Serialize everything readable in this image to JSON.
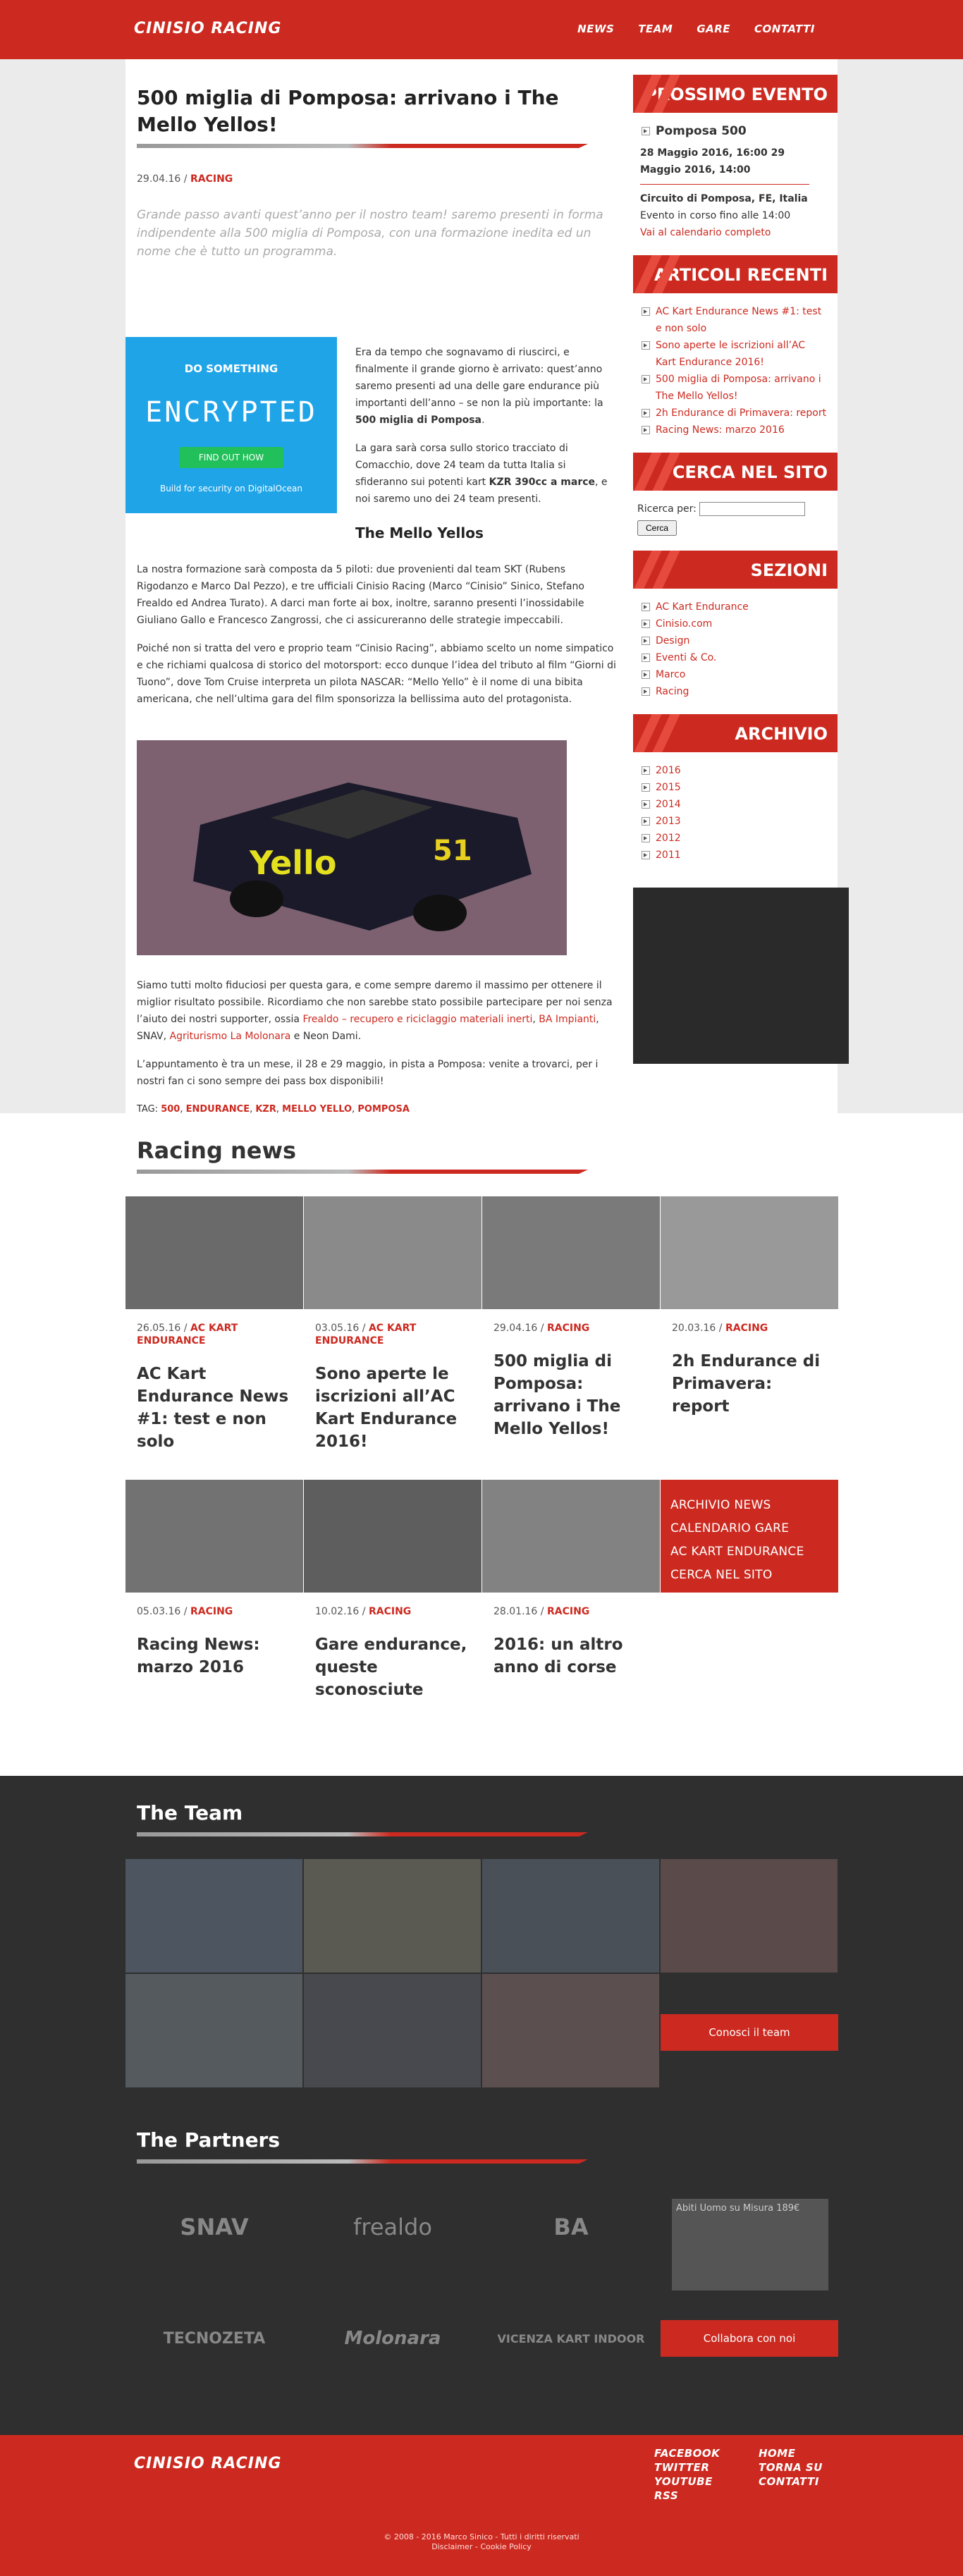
{
  "header": {
    "logo": "CINISIO RACING",
    "nav": [
      "NEWS",
      "TEAM",
      "GARE",
      "CONTATTI"
    ]
  },
  "post": {
    "title": "500 miglia di Pomposa: arrivano i The Mello Yellos!",
    "date": "29.04.16",
    "category": "RACING",
    "lead": "Grande passo avanti quest’anno per il nostro team! saremo presenti in forma indipendente alla 500 miglia di Pomposa, con una formazione inedita ed un nome che è tutto un programma.",
    "p1_a": "Era da tempo che sognavamo di riuscirci, e finalmente il grande giorno è arrivato: quest’anno saremo presenti ad una delle gare endurance più importanti dell’anno – se non la più importante: la ",
    "p1_b": "500 miglia di Pomposa",
    "p1_c": ".",
    "p2_a": "La gara sarà corsa sullo storico tracciato di Comacchio, dove 24 team da tutta Italia si sfideranno sui potenti kart ",
    "p2_b": "KZR 390cc a marce",
    "p2_c": ", e noi saremo uno dei 24 team presenti.",
    "subheading": "The Mello Yellos",
    "p3": "La nostra formazione sarà composta da 5 piloti: due provenienti dal team SKT (Rubens Rigodanzo e Marco Dal Pezzo), e tre ufficiali Cinisio Racing (Marco “Cinisio” Sinico, Stefano Frealdo ed Andrea Turato). A darci man forte ai box, inoltre, saranno presenti l’inossidabile Giuliano Gallo e Francesco Zangrossi, che ci assicureranno delle strategie impeccabili.",
    "p4": "Poiché non si tratta del vero e proprio team “Cinisio Racing”, abbiamo scelto un nome simpatico e che richiami qualcosa di storico del motorsport: ecco dunque l’idea del tributo al film “Giorni di Tuono”, dove Tom Cruise interpreta un pilota NASCAR: “Mello Yello” è il nome di una bibita americana, che nell’ultima gara del film sponsorizza la bellissima auto del protagonista.",
    "p5_a": "Siamo tutti molto fiduciosi per questa gara, e come sempre daremo il massimo per ottenere il miglior risultato possibile. Ricordiamo che non sarebbe stato possibile partecipare per noi senza l’aiuto dei nostri supporter, ossia ",
    "p5_link1": "Frealdo – recupero e riciclaggio materiali inerti",
    "p5_sep1": ", ",
    "p5_link2": "BA Impianti",
    "p5_b": ", SNAV, ",
    "p5_link3": "Agriturismo La Molonara",
    "p5_c": " e Neon Dami.",
    "p6": "L’appuntamento è tra un mese, il 28 e 29 maggio, in pista a Pomposa: venite a trovarci, per i nostri fan ci sono sempre dei pass box disponibili!",
    "tags_label": "TAG:",
    "tags": [
      "500",
      "ENDURANCE",
      "KZR",
      "MELLO YELLO",
      "POMPOSA"
    ]
  },
  "ad": {
    "line1": "DO SOMETHING",
    "line2": "ENCRYPTED",
    "button": "FIND OUT HOW",
    "line3": "Build for security on DigitalOcean"
  },
  "sidebar": {
    "next_event": {
      "title": "PROSSIMO EVENTO",
      "name": "Pomposa 500",
      "dates": "28 Maggio 2016, 16:00 29 Maggio 2016, 14:00",
      "place": "Circuito di Pomposa, FE, Italia",
      "status": "Evento in corso fino alle 14:00",
      "link": "Vai al calendario completo"
    },
    "recent": {
      "title": "ARTICOLI RECENTI",
      "items": [
        "AC Kart Endurance News #1: test e non solo",
        "Sono aperte le iscrizioni all’AC Kart Endurance 2016!",
        "500 miglia di Pomposa: arrivano i The Mello Yellos!",
        "2h Endurance di Primavera: report",
        "Racing News: marzo 2016"
      ]
    },
    "search": {
      "title": "CERCA NEL SITO",
      "label": "Ricerca per:",
      "button": "Cerca"
    },
    "sections": {
      "title": "SEZIONI",
      "items": [
        "AC Kart Endurance",
        "Cinisio.com",
        "Design",
        "Eventi & Co.",
        "Marco",
        "Racing"
      ]
    },
    "archive": {
      "title": "ARCHIVIO",
      "items": [
        "2016",
        "2015",
        "2014",
        "2013",
        "2012",
        "2011"
      ]
    }
  },
  "racing_news": {
    "title": "Racing news",
    "tiles": [
      {
        "date": "26.05.16",
        "cat": "AC KART ENDURANCE",
        "title": "AC Kart Endurance News #1: test e non solo"
      },
      {
        "date": "03.05.16",
        "cat": "AC KART ENDURANCE",
        "title": "Sono aperte le iscrizioni all’AC Kart Endurance 2016!"
      },
      {
        "date": "29.04.16",
        "cat": "RACING",
        "title": "500 miglia di Pomposa: arrivano i The Mello Yellos!"
      },
      {
        "date": "20.03.16",
        "cat": "RACING",
        "title": "2h Endurance di Primavera: report"
      },
      {
        "date": "05.03.16",
        "cat": "RACING",
        "title": "Racing News: marzo 2016"
      },
      {
        "date": "10.02.16",
        "cat": "RACING",
        "title": "Gare endurance, queste sconosciute"
      },
      {
        "date": "28.01.16",
        "cat": "RACING",
        "title": "2016: un altro anno di corse"
      }
    ],
    "links": [
      "ARCHIVIO NEWS",
      "CALENDARIO GARE",
      "AC KART ENDURANCE",
      "CERCA NEL SITO"
    ]
  },
  "team": {
    "title": "The Team",
    "button": "Conosci il team"
  },
  "partners": {
    "title": "The Partners",
    "logos": [
      "SNAV",
      "frealdo",
      "BA",
      "TECNOZETA",
      "Molonara",
      "VICENZA KART INDOOR"
    ],
    "ad_title": "Abiti Uomo su Misura 189€",
    "button": "Collabora con noi"
  },
  "footer": {
    "logo": "CINISIO RACING",
    "col1": [
      "FACEBOOK",
      "TWITTER",
      "YOUTUBE",
      "RSS"
    ],
    "col2": [
      "HOME",
      "TORNA SU",
      "CONTATTI"
    ],
    "copy": "© 2008 - 2016 Marco Sinico - Tutti i diritti riservati",
    "disclaimer": "Disclaimer - Cookie Policy"
  }
}
